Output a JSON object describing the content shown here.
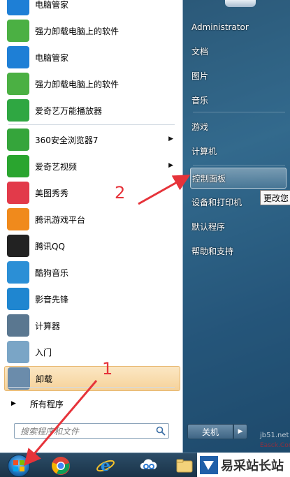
{
  "programs": [
    {
      "label": "电脑管家",
      "icon": "tencent-pc-manager-icon",
      "color": "#1e7fd6"
    },
    {
      "label": "强力卸载电脑上的软件",
      "icon": "uninstall-clover-icon",
      "color": "#4bb043"
    },
    {
      "label": "电脑管家",
      "icon": "tencent-pc-manager-icon",
      "color": "#1e7fd6"
    },
    {
      "label": "强力卸载电脑上的软件",
      "icon": "uninstall-clover-icon",
      "color": "#4bb043"
    },
    {
      "label": "爱奇艺万能播放器",
      "icon": "iqiyi-player-icon",
      "color": "#2fa742"
    },
    {
      "label": "360安全浏览器7",
      "icon": "360-browser-icon",
      "color": "#35a53b"
    },
    {
      "label": "爱奇艺视频",
      "icon": "iqiyi-video-icon",
      "color": "#2aa52f"
    },
    {
      "label": "美图秀秀",
      "icon": "meitu-icon",
      "color": "#e23a4a"
    },
    {
      "label": "腾讯游戏平台",
      "icon": "tencent-games-icon",
      "color": "#f08a1c"
    },
    {
      "label": "腾讯QQ",
      "icon": "qq-penguin-icon",
      "color": "#222222"
    },
    {
      "label": "酷狗音乐",
      "icon": "kugou-icon",
      "color": "#2b8fd6"
    },
    {
      "label": "影音先锋",
      "icon": "xfplay-icon",
      "color": "#1f86d0"
    },
    {
      "label": "计算器",
      "icon": "calculator-icon",
      "color": "#5a7790"
    },
    {
      "label": "入门",
      "icon": "getting-started-icon",
      "color": "#7aa5c6"
    },
    {
      "label": "卸载",
      "icon": "uninstall-doc-icon",
      "color": "#6b8cab"
    }
  ],
  "all_programs": "所有程序",
  "search": {
    "placeholder": "搜索程序和文件"
  },
  "right_items": [
    {
      "label": "Administrator"
    },
    {
      "label": "文档"
    },
    {
      "label": "图片"
    },
    {
      "label": "音乐"
    },
    {
      "label": "游戏"
    },
    {
      "label": "计算机"
    },
    {
      "label": "控制面板"
    },
    {
      "label": "设备和打印机"
    },
    {
      "label": "默认程序"
    },
    {
      "label": "帮助和支持"
    }
  ],
  "tooltip": "更改您",
  "shutdown": {
    "label": "关机"
  },
  "annotations": {
    "step1": "1",
    "step2": "2"
  },
  "watermark": {
    "text": "易采站长站",
    "faint": "jb51.net",
    "faint2": "Easck.Com"
  },
  "colors": {
    "highlight": "#f6d29a",
    "annotation_red": "#e6333a"
  }
}
